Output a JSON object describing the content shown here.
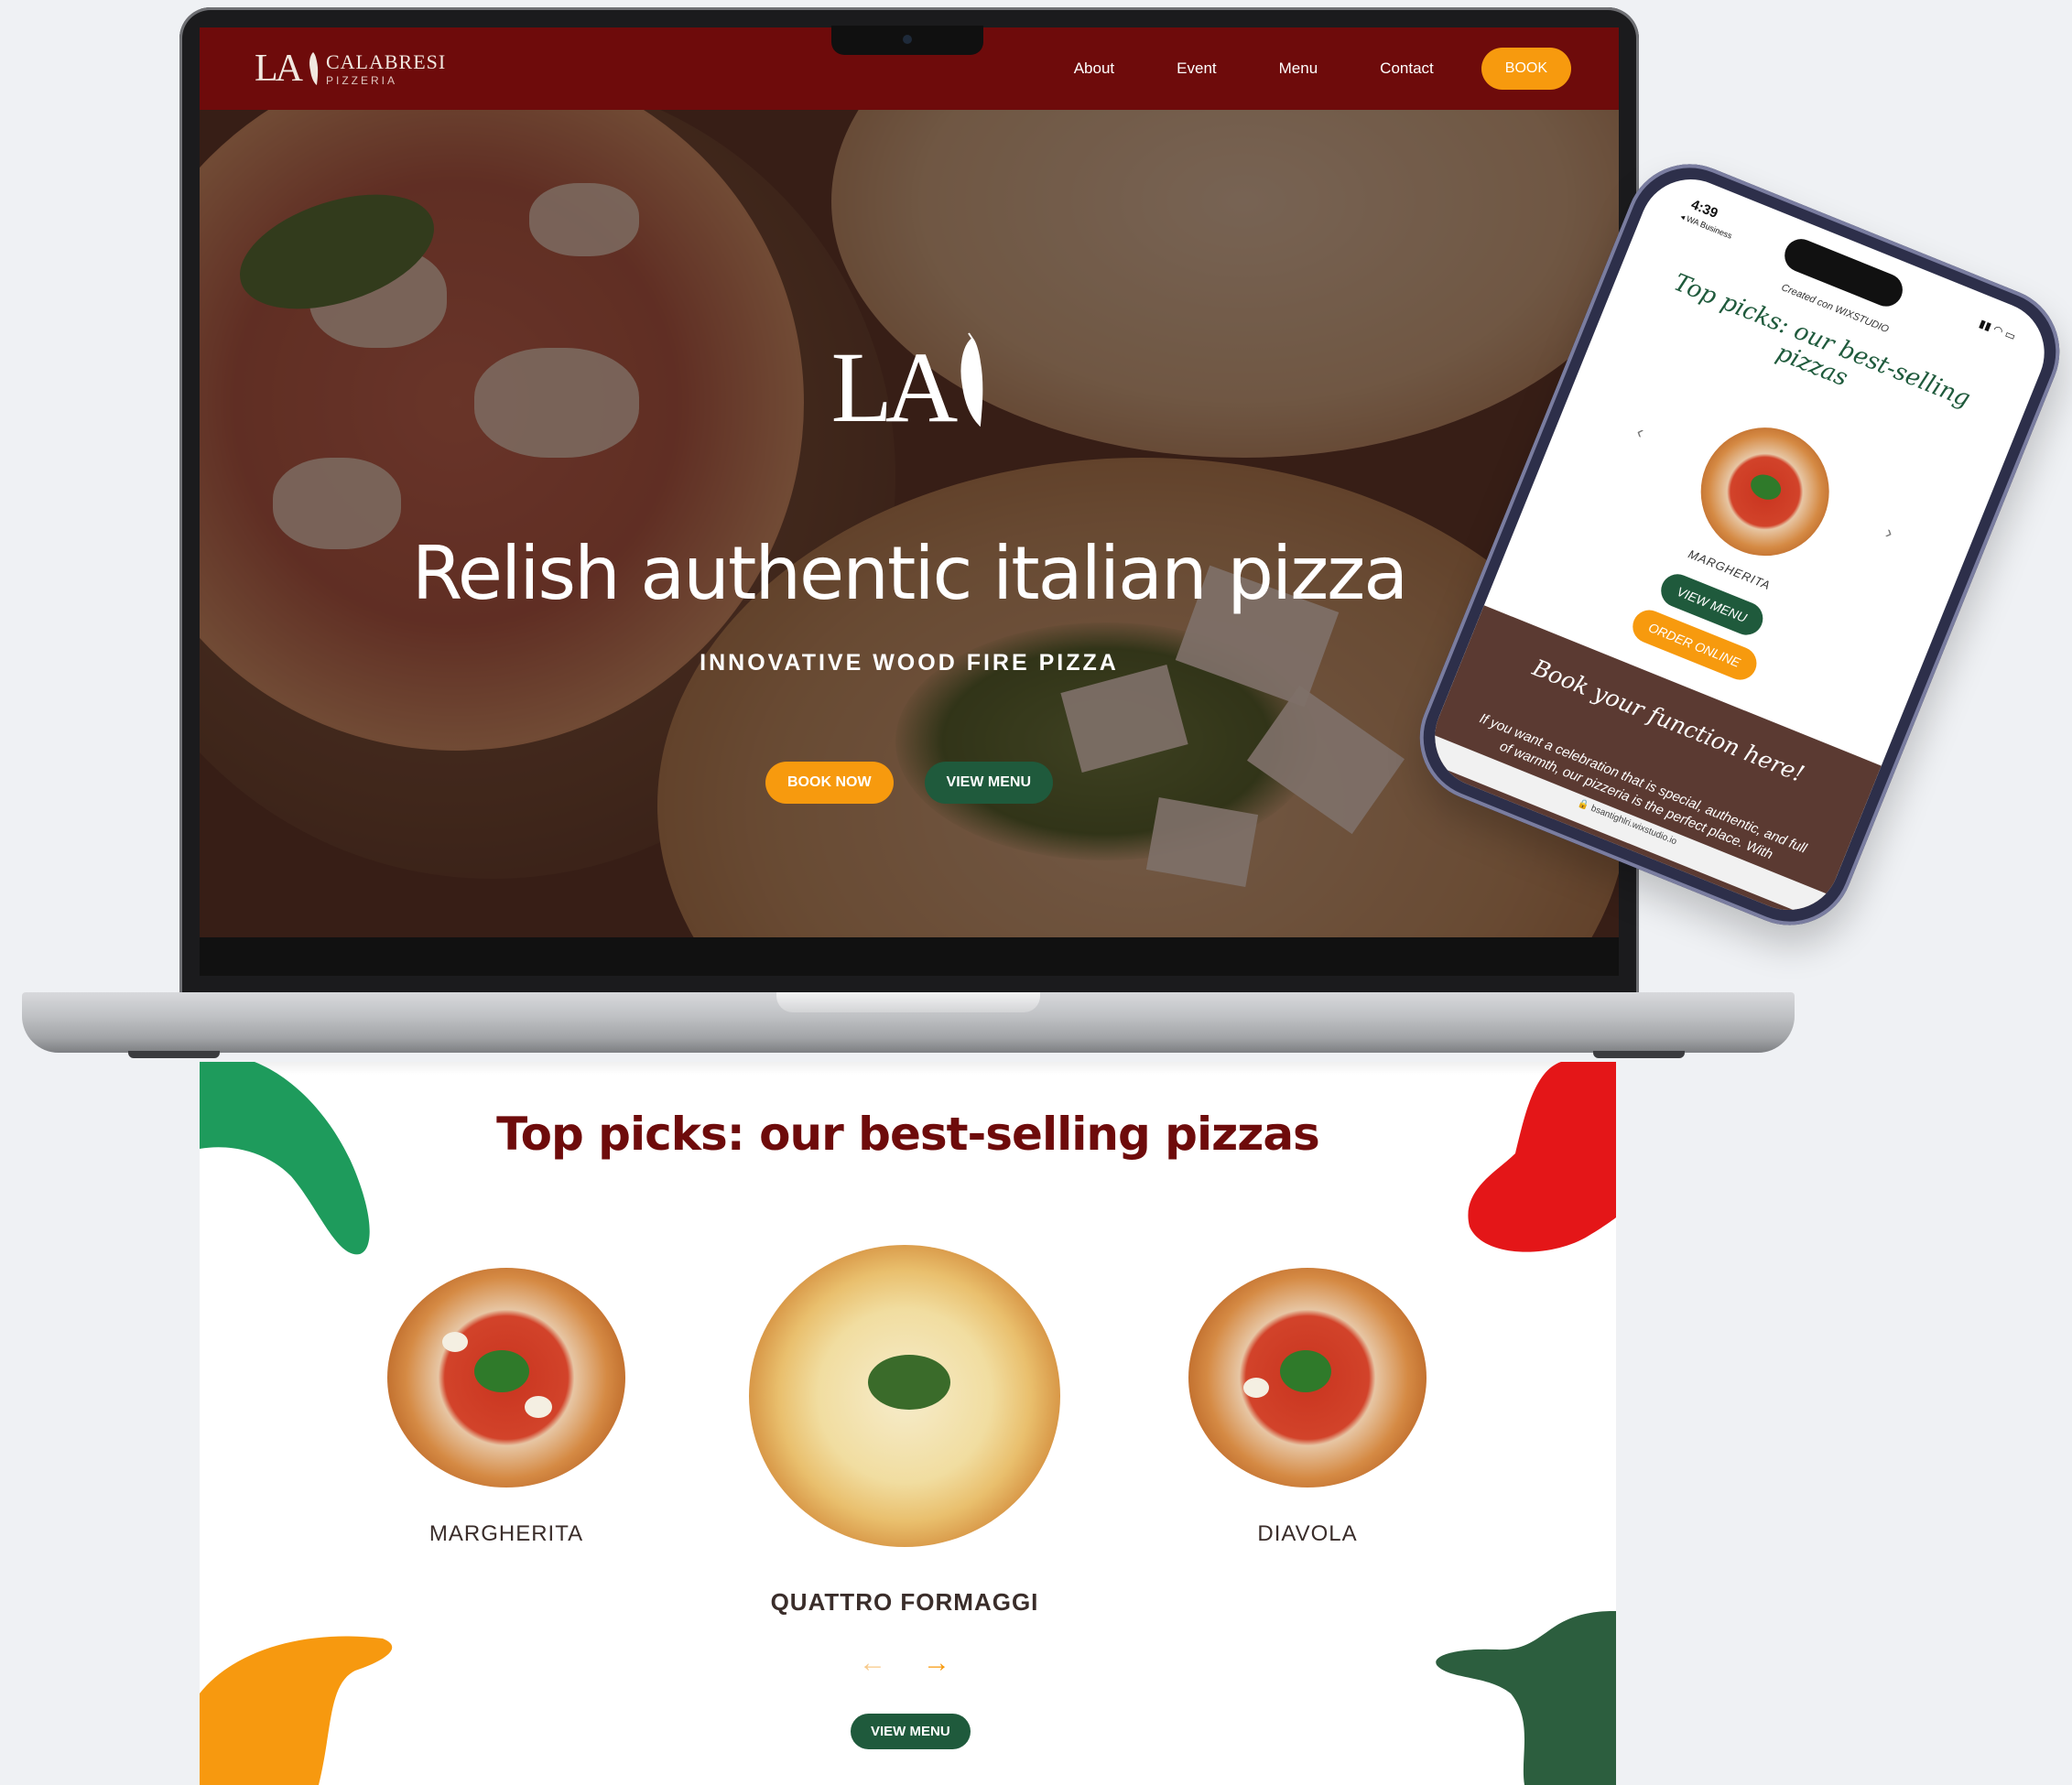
{
  "header": {
    "logo_mark": "LA",
    "logo_name": "CALABRESI",
    "logo_sub": "PIZZERIA",
    "nav": [
      "About",
      "Event",
      "Menu",
      "Contact"
    ],
    "book_label": "BOOK"
  },
  "hero": {
    "logo_mark": "LA",
    "title": "Relish authentic italian pizza",
    "subtitle": "INNOVATIVE WOOD FIRE PIZZA",
    "book_now": "BOOK NOW",
    "view_menu": "VIEW MENU"
  },
  "best_sellers": {
    "title": "Top picks: our best-selling pizzas",
    "pizzas": [
      "MARGHERITA",
      "QUATTRO FORMAGGI",
      "DIAVOLA"
    ],
    "view_menu": "VIEW MENU"
  },
  "phone": {
    "time": "4:39",
    "carrier": "◂ WA Business",
    "created": "Created con WIXSTUDIO",
    "title": "Top picks: our best-selling pizzas",
    "pizza_name": "MARGHERITA",
    "view_menu": "VIEW MENU",
    "order_online": "ORDER ONLINE",
    "book_title": "Book your function here!",
    "book_text": "If you want a celebration that is special, authentic, and full of warmth, our pizzeria is the perfect place. With",
    "url": "🔒 bsantighlri.wixstudio.io"
  },
  "colors": {
    "brand_red": "#6e0b0b",
    "accent_orange": "#f79a0e",
    "accent_green": "#1f5a3c"
  }
}
